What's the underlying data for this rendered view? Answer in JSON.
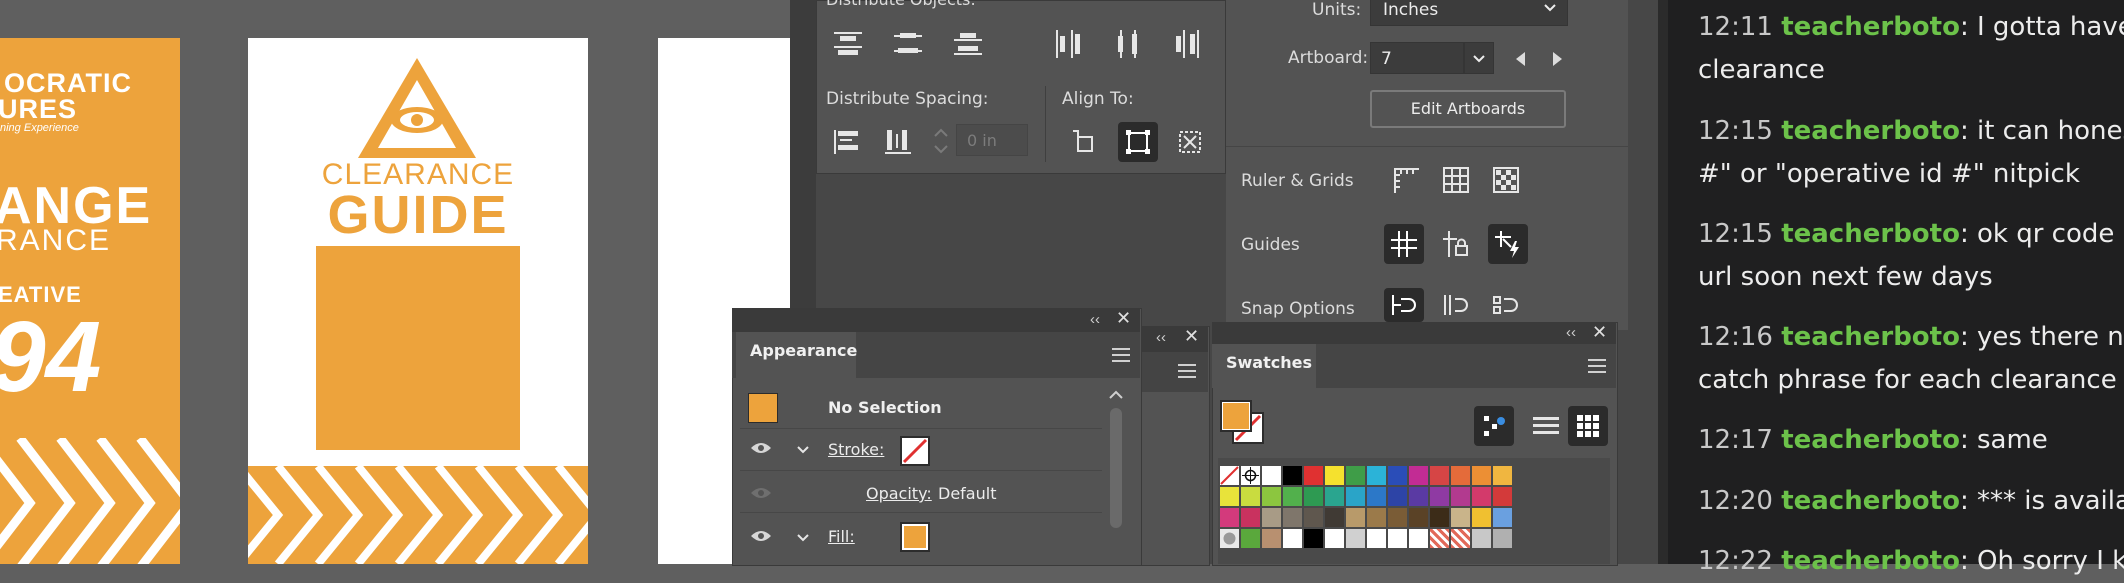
{
  "canvas": {
    "left_poster": {
      "brand_line1": "OCRATIC",
      "brand_line2": "URES",
      "brand_tagline": "ning Experience",
      "headline1": "ANGE",
      "headline2": "RANCE",
      "sub": "EATIVE",
      "number": "94"
    },
    "center_poster": {
      "title_line1": "CLEARANCE",
      "title_line2": "GUIDE"
    },
    "accent": "#eda33c"
  },
  "align_panel": {
    "distribute_objects_label": "Distribute Objects:",
    "distribute_spacing_label": "Distribute Spacing:",
    "align_to_label": "Align To:",
    "spacing_value": "0 in"
  },
  "document_panel": {
    "units_label": "Units:",
    "units_value": "Inches",
    "artboard_label": "Artboard:",
    "artboard_value": "7",
    "edit_artboards_label": "Edit Artboards",
    "ruler_grids_label": "Ruler & Grids",
    "guides_label": "Guides",
    "snap_options_label": "Snap Options"
  },
  "appearance_panel": {
    "tab": "Appearance",
    "selection": "No Selection",
    "stroke_label": "Stroke:",
    "opacity_label": "Opacity:",
    "opacity_value": "Default",
    "fill_label": "Fill:"
  },
  "swatches_panel": {
    "tab": "Swatches"
  },
  "chat": {
    "messages": [
      {
        "time": "12:11",
        "user": "teacherboto",
        "line1": ": I gotta have t",
        "line2": "clearance"
      },
      {
        "time": "12:15",
        "user": "teacherboto",
        "line1": ": it can honest",
        "line2": "#\" or \"operative id #\" nitpick"
      },
      {
        "time": "12:15",
        "user": "teacherboto",
        "line1": ": ok qr code a",
        "line2": "url soon next few days"
      },
      {
        "time": "12:16",
        "user": "teacherboto",
        "line1": ": yes there ne",
        "line2": "catch phrase for each clearance"
      },
      {
        "time": "12:17",
        "user": "teacherboto",
        "line1": ": same",
        "line2": ""
      },
      {
        "time": "12:20",
        "user": "teacherboto",
        "line1": ": *** is availab",
        "line2": ""
      },
      {
        "time": "12:22",
        "user": "teacherboto",
        "line1": ": Oh sorry I kn",
        "line2": ""
      }
    ]
  }
}
